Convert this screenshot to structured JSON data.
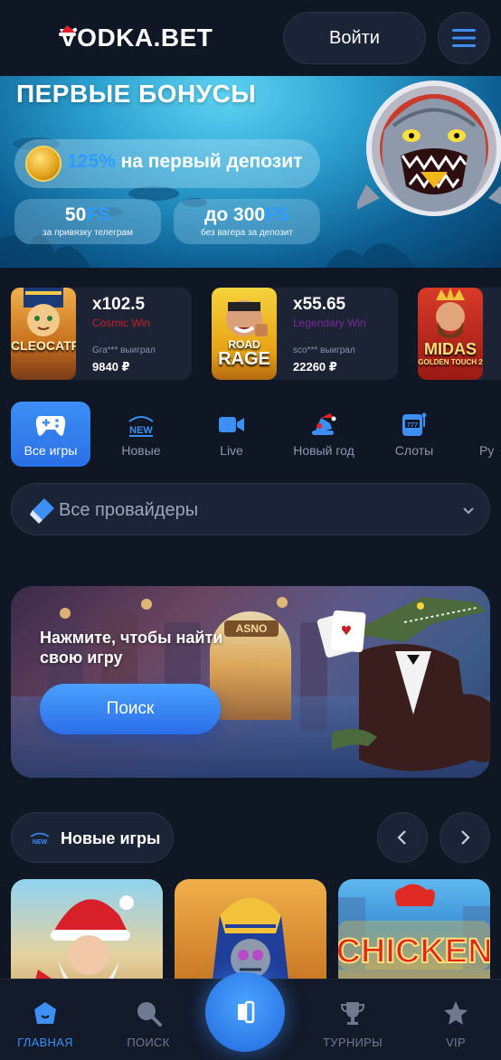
{
  "header": {
    "logo_text": "VODKA.BET",
    "login_label": "Войти"
  },
  "banner": {
    "title": "ПЕРВЫЕ БОНУСЫ",
    "main_percent": "125%",
    "main_text": "на первый депозит",
    "card1_value": "50",
    "card1_unit": "FS",
    "card1_caption": "за привязку телеграм",
    "card2_value": "до 300",
    "card2_unit": "FS",
    "card2_caption": "без вагера за депозит"
  },
  "winners": [
    {
      "multiplier": "x102.5",
      "game": "Cosmic Win",
      "thumb_text": "CLEOCATRA",
      "user": "Gra*** выиграл",
      "amount": "9840 ₽"
    },
    {
      "multiplier": "x55.65",
      "game": "Legendary Win",
      "thumb_text_top": "ROAD",
      "thumb_text": "RAGE",
      "user": "sco*** выиграл",
      "amount": "22260 ₽"
    },
    {
      "thumb_text": "MIDAS",
      "thumb_sub": "GOLDEN TOUCH 2"
    }
  ],
  "categories": [
    {
      "label": "Все игры",
      "icon": "gamepad-icon",
      "active": true
    },
    {
      "label": "Новые",
      "icon": "new-badge-icon"
    },
    {
      "label": "Live",
      "icon": "video-camera-icon"
    },
    {
      "label": "Новый год",
      "icon": "santa-hat-icon"
    },
    {
      "label": "Слоты",
      "icon": "slot-machine-icon"
    },
    {
      "label": "Ру"
    }
  ],
  "providers": {
    "label": "Все провайдеры"
  },
  "promo": {
    "message": "Нажмите, чтобы найти свою игру",
    "search_label": "Поиск",
    "door_sign": "ASNO"
  },
  "new_games": {
    "title": "Новые игры",
    "badge_text": "NEW",
    "games": [
      {
        "thumb_text": ""
      },
      {
        "thumb_text": ""
      },
      {
        "thumb_text": "CHICKEN"
      }
    ]
  },
  "bottom_nav": [
    {
      "label": "ГЛАВНАЯ",
      "icon": "home-icon",
      "active": true
    },
    {
      "label": "ПОИСК",
      "icon": "search-icon"
    },
    {
      "label": "ТУРНИРЫ",
      "icon": "trophy-icon"
    },
    {
      "label": "VIP",
      "icon": "star-icon"
    }
  ],
  "colors": {
    "accent": "#3d8ef5",
    "background": "#0f1624",
    "card": "#1b2436"
  }
}
